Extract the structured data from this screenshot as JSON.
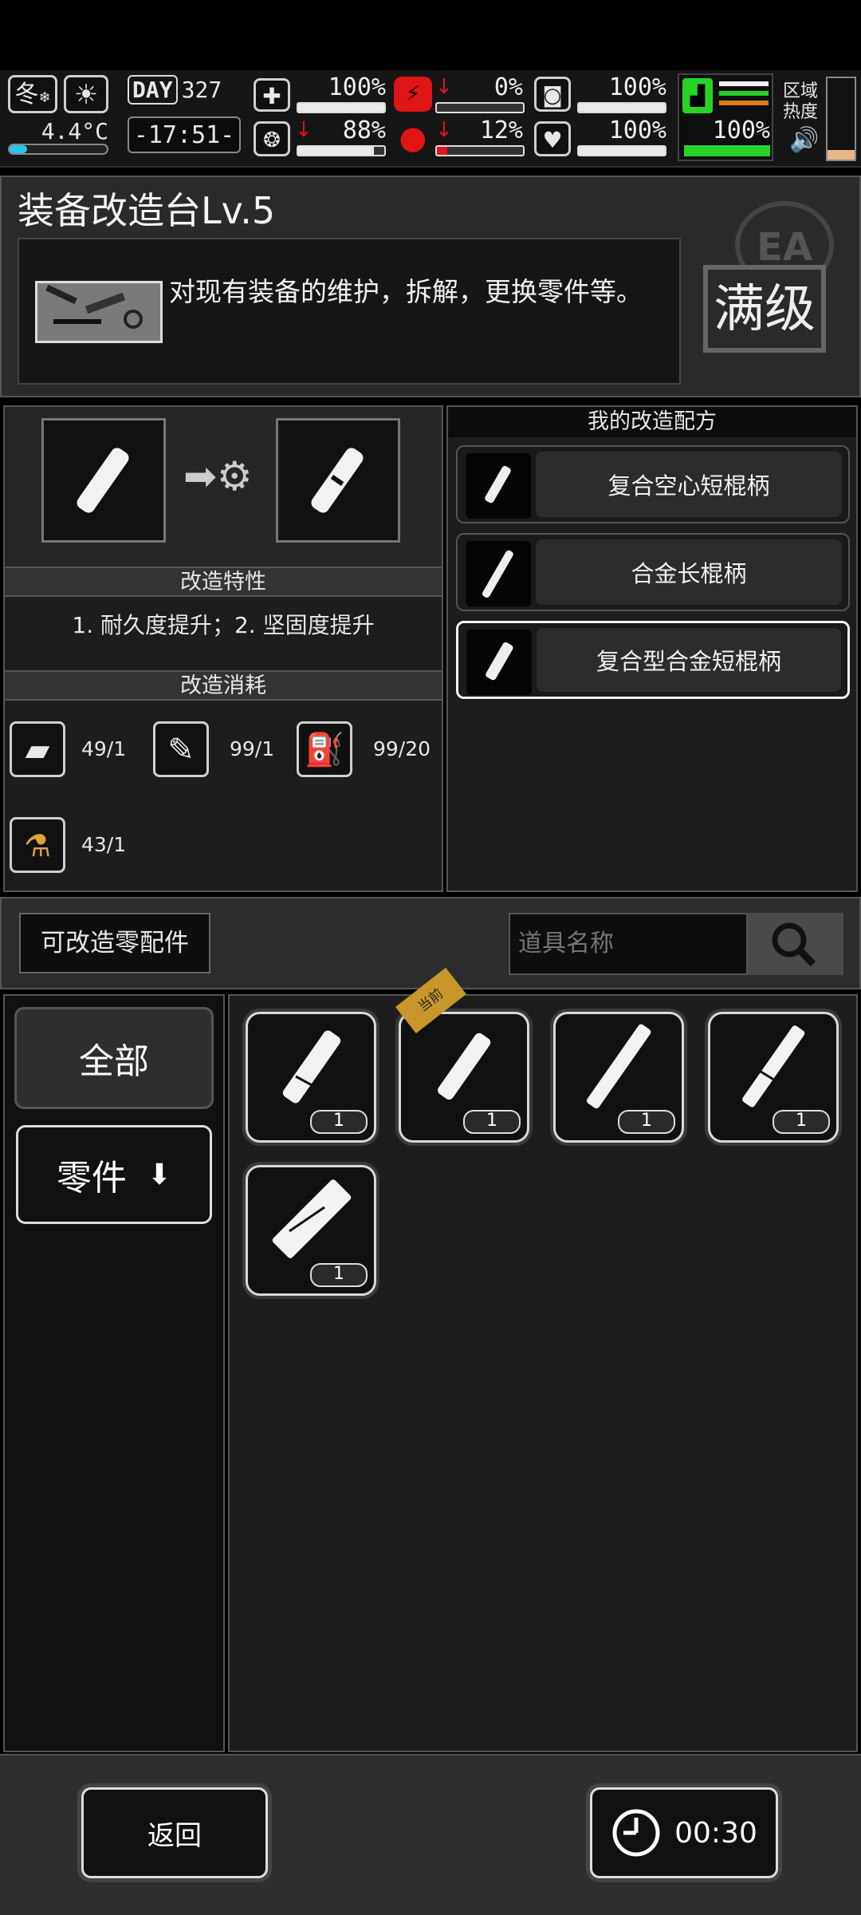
{
  "hud": {
    "season": "冬",
    "temperature": "4.4°C",
    "day_label": "DAY",
    "day_number": "327",
    "clock": "-17:51-",
    "stats": {
      "health": "100%",
      "hunger": "0%",
      "thirst": "100%",
      "mental": "88%",
      "blood": "12%",
      "heart": "100%",
      "stamina": "100%"
    },
    "bars": {
      "health": 1.0,
      "hunger": 0.0,
      "thirst": 1.0,
      "mental": 0.88,
      "blood": 0.12,
      "heart": 1.0,
      "stamina": 1.0
    },
    "zone_heat_label_1": "区域",
    "zone_heat_label_2": "热度",
    "zone_heat_level": 0.12
  },
  "workbench": {
    "title": "装备改造台Lv.5",
    "description": "对现有装备的维护，拆解，更换零件等。",
    "badge_text": "满级",
    "badge_stamp": "EA"
  },
  "modify": {
    "traits_header": "改造特性",
    "traits_text": "1. 耐久度提升；2. 坚固度提升",
    "cost_header": "改造消耗",
    "costs": [
      {
        "icon": "cloth-icon",
        "value": "49/1"
      },
      {
        "icon": "syringe-icon",
        "value": "99/1"
      },
      {
        "icon": "fuel-can-icon",
        "value": "99/20"
      },
      {
        "icon": "flask-icon",
        "value": "43/1"
      }
    ]
  },
  "recipes": {
    "header": "我的改造配方",
    "items": [
      {
        "label": "复合空心短棍柄"
      },
      {
        "label": "合金长棍柄"
      },
      {
        "label": "复合型合金短棍柄"
      }
    ]
  },
  "parts": {
    "title": "可改造零配件",
    "search_placeholder": "道具名称",
    "categories": [
      {
        "label": "全部"
      },
      {
        "label": "零件"
      }
    ],
    "current_tag": "当前",
    "slots": [
      {
        "count": "1"
      },
      {
        "count": "1"
      },
      {
        "count": "1"
      },
      {
        "count": "1"
      },
      {
        "count": "1"
      }
    ]
  },
  "footer": {
    "back_label": "返回",
    "timer": "00:30"
  },
  "colors": {
    "accent_gold": "#c8962b",
    "danger_red": "#e01515",
    "stamina_green": "#27d327"
  }
}
